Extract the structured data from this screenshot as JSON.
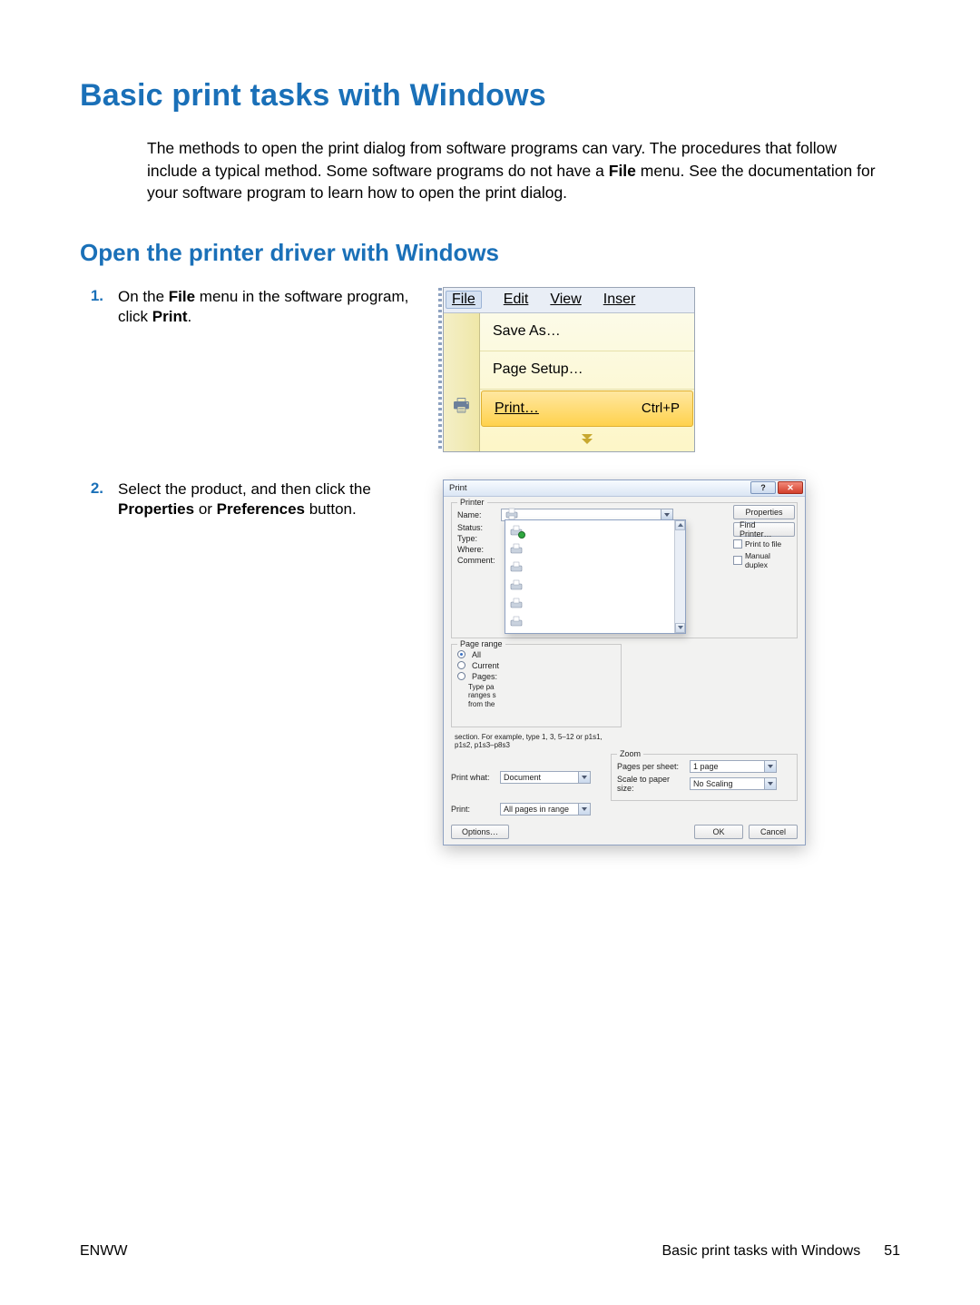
{
  "title": "Basic print tasks with Windows",
  "intro_parts": {
    "a": "The methods to open the print dialog from software programs can vary. The procedures that follow include a typical method. Some software programs do not have a ",
    "b": "File",
    "c": " menu. See the documentation for your software program to learn how to open the print dialog."
  },
  "subtitle": "Open the printer driver with Windows",
  "steps": [
    {
      "num": "1.",
      "parts": {
        "a": "On the ",
        "b": "File",
        "c": " menu in the software program, click ",
        "d": "Print",
        "e": "."
      }
    },
    {
      "num": "2.",
      "parts": {
        "a": "Select the product, and then click the ",
        "b": "Properties",
        "c": " or ",
        "d": "Preferences",
        "e": " button."
      }
    }
  ],
  "filemenu": {
    "bar": {
      "file": "File",
      "edit": "Edit",
      "view": "View",
      "insert": "Inser"
    },
    "items": {
      "save_as": "Save As…",
      "page_setup": "Page Setup…",
      "print": "Print…",
      "print_shortcut": "Ctrl+P"
    }
  },
  "printdlg": {
    "title": "Print",
    "help_glyph": "?",
    "close_glyph": "✕",
    "groups": {
      "printer": "Printer",
      "page_range": "Page range",
      "zoom": "Zoom"
    },
    "labels": {
      "name": "Name:",
      "status": "Status:",
      "type": "Type:",
      "where": "Where:",
      "comment": "Comment:",
      "print_what": "Print what:",
      "print": "Print:",
      "pages_per_sheet": "Pages per sheet:",
      "scale": "Scale to paper size:"
    },
    "buttons": {
      "properties": "Properties",
      "find_printer": "Find Printer…",
      "options": "Options…",
      "ok": "OK",
      "cancel": "Cancel"
    },
    "checks": {
      "print_to_file": "Print to file",
      "manual_duplex": "Manual duplex"
    },
    "range": {
      "all": "All",
      "current": "Current",
      "pages": "Pages:",
      "hint1": "Type pa",
      "hint2": "ranges s",
      "hint3": "from the",
      "hint_tail": "section. For example, type 1, 3, 5–12 or p1s1, p1s2, p1s3–p8s3"
    },
    "values": {
      "print_what": "Document",
      "print": "All pages in range",
      "pages_per_sheet": "1 page",
      "scale": "No Scaling"
    }
  },
  "footer": {
    "left": "ENWW",
    "right_text": "Basic print tasks with Windows",
    "page": "51"
  }
}
